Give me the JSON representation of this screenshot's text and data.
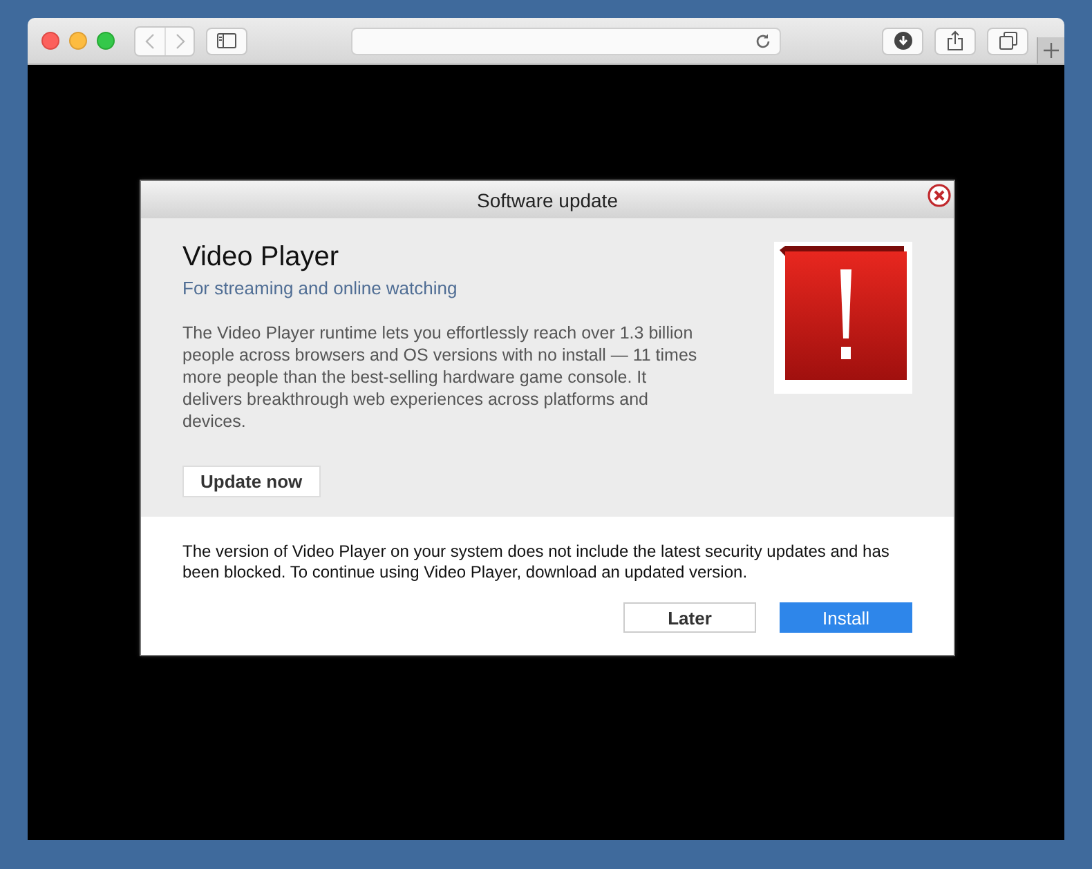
{
  "browser": {
    "nav_buttons": [
      {
        "kind": "back",
        "disabled": true
      },
      {
        "kind": "forward",
        "disabled": true
      }
    ]
  },
  "dialog": {
    "title": "Software update",
    "app_name": "Video Player",
    "tagline": "For streaming and online watching",
    "description": "The Video Player runtime lets you effortlessly reach over 1.3 billion people across browsers and OS versions with no install — 11 times more people than the best-selling hardware game console. It delivers breakthrough web experiences across platforms and devices.",
    "update_button": "Update now",
    "notice": "The version of Video Player on your system does not include the latest security updates and has been blocked. To continue using Video Player, download an updated version.",
    "buttons": [
      {
        "label": "Later",
        "kind": "secondary"
      },
      {
        "label": "Install",
        "kind": "primary"
      }
    ]
  }
}
